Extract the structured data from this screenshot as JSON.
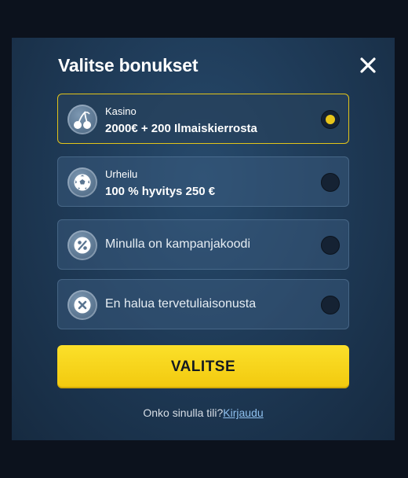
{
  "modal": {
    "title": "Valitse bonukset",
    "close_icon": "close-x-icon"
  },
  "options": [
    {
      "icon": "cherries-icon",
      "sub": "Kasino",
      "main": "2000€ + 200 Ilmaiskierrosta",
      "selected": true
    },
    {
      "icon": "soccer-ball-icon",
      "sub": "Urheilu",
      "main": "100 % hyvitys 250 €",
      "selected": false
    },
    {
      "icon": "percent-icon",
      "label": "Minulla on kampanjakoodi",
      "selected": false
    },
    {
      "icon": "x-circle-icon",
      "label": "En halua tervetuliaisonusta",
      "selected": false
    }
  ],
  "cta": {
    "label": "VALITSE"
  },
  "footer": {
    "text": "Onko sinulla tili?",
    "link": "Kirjaudu"
  },
  "colors": {
    "page_bg": "#0c121d",
    "modal_bg": "#1f3b58",
    "accent_yellow": "#f2c90e",
    "selected_border": "#e2c419",
    "link": "#8fc0ee"
  }
}
